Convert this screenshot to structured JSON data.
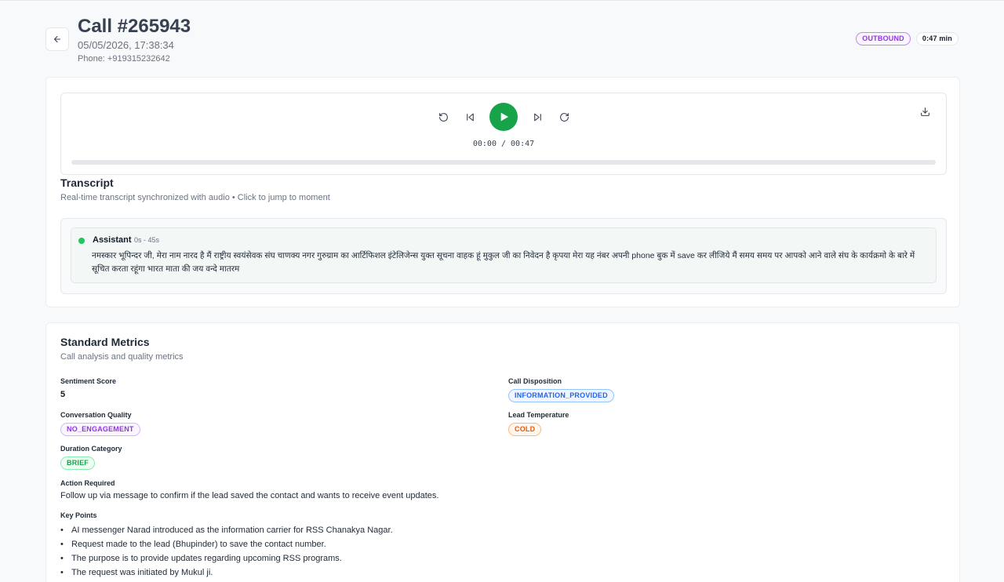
{
  "header": {
    "title": "Call #265943",
    "datetime": "05/05/2026, 17:38:34",
    "phone": "Phone: +919315232642",
    "direction_badge": "OUTBOUND",
    "duration_badge": "0:47 min"
  },
  "player": {
    "time": "00:00 / 00:47",
    "progress": 0
  },
  "transcript": {
    "title": "Transcript",
    "subtitle": "Real-time transcript synchronized with audio • Click to jump to moment",
    "messages": [
      {
        "speaker": "Assistant",
        "range": "0s - 45s",
        "text": "नमस्कार भूपिन्दर जी, मेरा नाम नारद है मैं राष्ट्रीय स्वयंसेवक संघ चाणक्य नगर गुरुग्राम का आर्टिफिशल इंटेलिजेन्स युक्त सूचना वाहक हूं मुकुल जी का निवेदन है कृपया मेरा यह नंबर अपनी phone बुक में save कर लीजिये मैं समय समय पर आपको आने वाले संघ के कार्यक्रमो के बारे में सूचित करता रहूंगा भारत माता की जय वन्दे मातरम"
      }
    ]
  },
  "metrics": {
    "title": "Standard Metrics",
    "subtitle": "Call analysis and quality metrics",
    "sentiment_label": "Sentiment Score",
    "sentiment_value": "5",
    "disposition_label": "Call Disposition",
    "disposition_value": "INFORMATION_PROVIDED",
    "quality_label": "Conversation Quality",
    "quality_value": "NO_ENGAGEMENT",
    "temperature_label": "Lead Temperature",
    "temperature_value": "COLD",
    "duration_label": "Duration Category",
    "duration_value": "BRIEF",
    "action_label": "Action Required",
    "action_value": "Follow up via message to confirm if the lead saved the contact and wants to receive event updates.",
    "key_points_label": "Key Points",
    "key_points": [
      "AI messenger Narad introduced as the information carrier for RSS Chanakya Nagar.",
      "Request made to the lead (Bhupinder) to save the contact number.",
      "The purpose is to provide updates regarding upcoming RSS programs.",
      "The request was initiated by Mukul ji."
    ]
  },
  "colors": {
    "accent_green": "#16a34a",
    "badge_purple": "#9333ea",
    "badge_blue": "#2563eb",
    "badge_orange": "#ea580c"
  }
}
